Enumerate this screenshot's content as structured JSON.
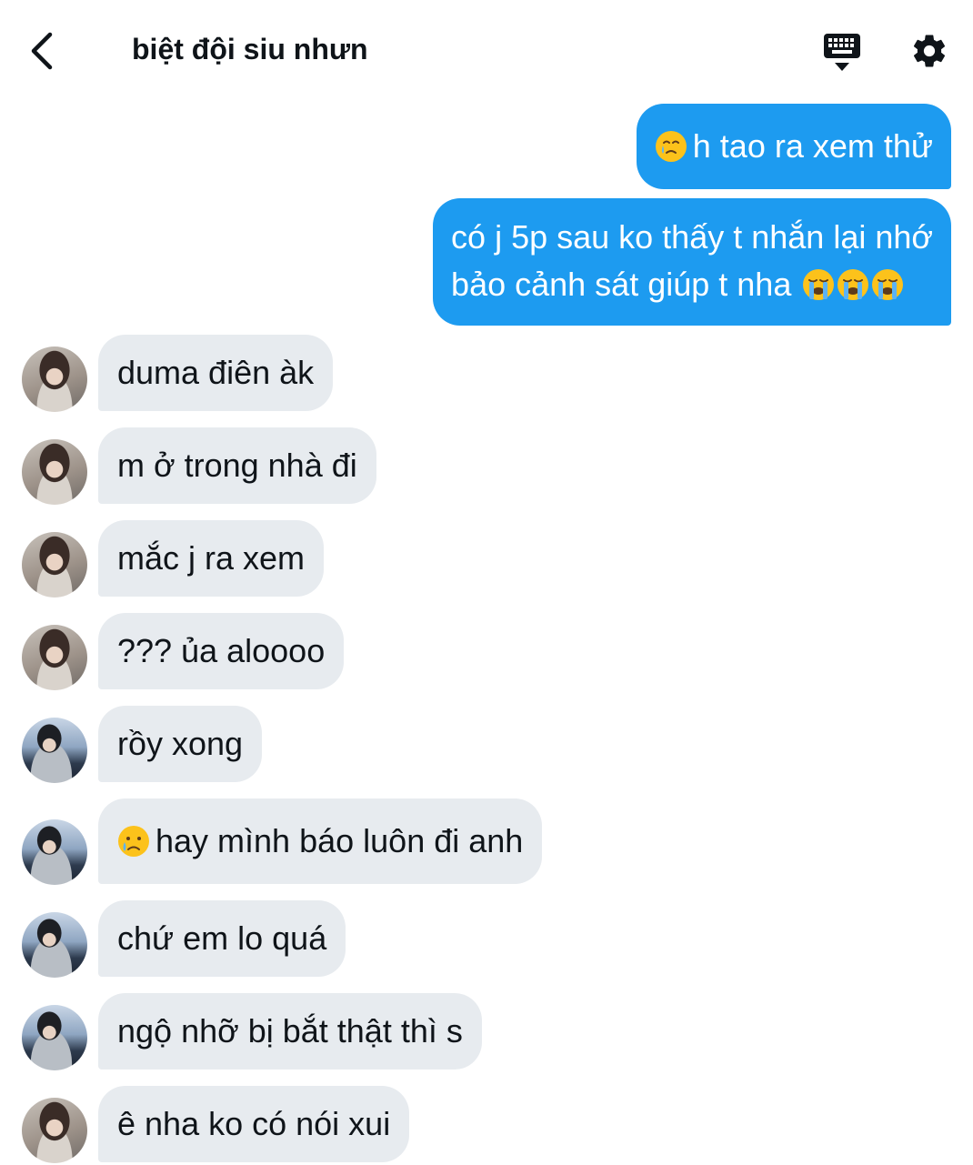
{
  "header": {
    "title": "biệt đội siu nhưn"
  },
  "icons": {
    "back": "back-arrow-icon",
    "keyboard": "keyboard-icon",
    "settings": "gear-icon",
    "sad_tear": "face-holding-back-tears-emoji",
    "crying": "loudly-crying-face-emoji",
    "sad_cry": "crying-face-emoji"
  },
  "colors": {
    "outgoing_bubble": "#1d9bf0",
    "incoming_bubble": "#e7ebef",
    "outgoing_text": "#ffffff",
    "incoming_text": "#0f1419"
  },
  "messages": [
    {
      "direction": "out",
      "lines": [
        "h tao ra xem thử"
      ],
      "emoji_prefix": "face-holding-back-tears-emoji"
    },
    {
      "direction": "out",
      "lines": [
        "có j 5p sau ko thấy t nhắn lại nhớ",
        "bảo cảnh sát giúp t nha"
      ],
      "emoji_suffix": [
        "loudly-crying-face-emoji",
        "loudly-crying-face-emoji",
        "loudly-crying-face-emoji"
      ]
    },
    {
      "direction": "in",
      "sender_avatar": "a",
      "text": "duma điên àk"
    },
    {
      "direction": "in",
      "sender_avatar": "a",
      "text": "m ở trong nhà đi"
    },
    {
      "direction": "in",
      "sender_avatar": "a",
      "text": "mắc j ra xem"
    },
    {
      "direction": "in",
      "sender_avatar": "a",
      "text": "??? ủa aloooo"
    },
    {
      "direction": "in",
      "sender_avatar": "b",
      "text": "rồy xong"
    },
    {
      "direction": "in",
      "sender_avatar": "b",
      "text": "hay mình báo luôn đi anh",
      "emoji_prefix": "crying-face-emoji"
    },
    {
      "direction": "in",
      "sender_avatar": "b",
      "text": "chứ em lo quá"
    },
    {
      "direction": "in",
      "sender_avatar": "b",
      "text": "ngộ nhỡ bị bắt thật thì s"
    },
    {
      "direction": "in",
      "sender_avatar": "a",
      "text": "ê nha ko có nói xui"
    }
  ]
}
